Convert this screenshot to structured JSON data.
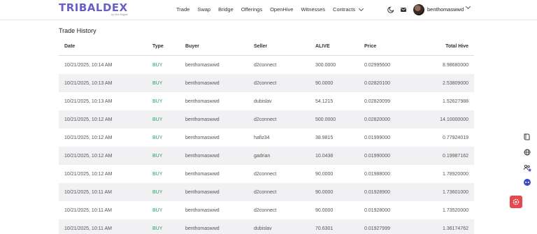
{
  "header": {
    "logo": "TRIBALDEX",
    "logo_sub": "by Hive Engine",
    "nav": [
      {
        "label": "Trade"
      },
      {
        "label": "Swap"
      },
      {
        "label": "Bridge"
      },
      {
        "label": "Offerings"
      },
      {
        "label": "OpenHive"
      },
      {
        "label": "Witnesses"
      },
      {
        "label": "Contracts"
      }
    ],
    "username": "benthomaswwd",
    "icons": [
      "moon-icon",
      "mail-icon",
      "avatar",
      "chevron-down-icon"
    ]
  },
  "trade_history": {
    "title": "Trade History",
    "columns": {
      "date": "Date",
      "type": "Type",
      "buyer": "Buyer",
      "seller": "Seller",
      "alive": "ALIVE",
      "price": "Price",
      "total": "Total Hive"
    },
    "rows": [
      {
        "date": "10/21/2025, 10:14 AM",
        "type": "BUY",
        "buyer": "benthomaswwd",
        "seller": "d2connect",
        "alive": "300.0000",
        "price": "0.02995600",
        "total": "8.98680000"
      },
      {
        "date": "10/21/2025, 10:13 AM",
        "type": "BUY",
        "buyer": "benthomaswwd",
        "seller": "d2connect",
        "alive": "90.0000",
        "price": "0.02820100",
        "total": "2.53809000"
      },
      {
        "date": "10/21/2025, 10:13 AM",
        "type": "BUY",
        "buyer": "benthomaswwd",
        "seller": "dubislav",
        "alive": "54.1215",
        "price": "0.02820099",
        "total": "1.52627988"
      },
      {
        "date": "10/21/2025, 10:12 AM",
        "type": "BUY",
        "buyer": "benthomaswwd",
        "seller": "d2connect",
        "alive": "500.0000",
        "price": "0.02820000",
        "total": "14.10000000"
      },
      {
        "date": "10/21/2025, 10:12 AM",
        "type": "BUY",
        "buyer": "benthomaswwd",
        "seller": "hafiz34",
        "alive": "38.9815",
        "price": "0.01999000",
        "total": "0.77924019"
      },
      {
        "date": "10/21/2025, 10:12 AM",
        "type": "BUY",
        "buyer": "benthomaswwd",
        "seller": "gadrian",
        "alive": "10.0438",
        "price": "0.01990000",
        "total": "0.19987162"
      },
      {
        "date": "10/21/2025, 10:12 AM",
        "type": "BUY",
        "buyer": "benthomaswwd",
        "seller": "d2connect",
        "alive": "90.0000",
        "price": "0.01988000",
        "total": "1.78920000"
      },
      {
        "date": "10/21/2025, 10:11 AM",
        "type": "BUY",
        "buyer": "benthomaswwd",
        "seller": "d2connect",
        "alive": "90.0000",
        "price": "0.01928900",
        "total": "1.73601000"
      },
      {
        "date": "10/21/2025, 10:11 AM",
        "type": "BUY",
        "buyer": "benthomaswwd",
        "seller": "d2connect",
        "alive": "90.0000",
        "price": "0.01928000",
        "total": "1.73520000"
      },
      {
        "date": "10/21/2025, 10:11 AM",
        "type": "BUY",
        "buyer": "benthomaswwd",
        "seller": "dubislav",
        "alive": "70.6301",
        "price": "0.01927999",
        "total": "1.36174762"
      }
    ]
  },
  "side_icons": [
    "book-icon",
    "globe-icon",
    "people-badge-icon",
    "chat-bot-icon"
  ],
  "fab": {
    "icon": "settings-gear-icon",
    "color": "#e5484d"
  },
  "colors": {
    "brand": "#6a5fc7",
    "buy": "#21a35a",
    "alt_row": "#f1f1f4"
  }
}
